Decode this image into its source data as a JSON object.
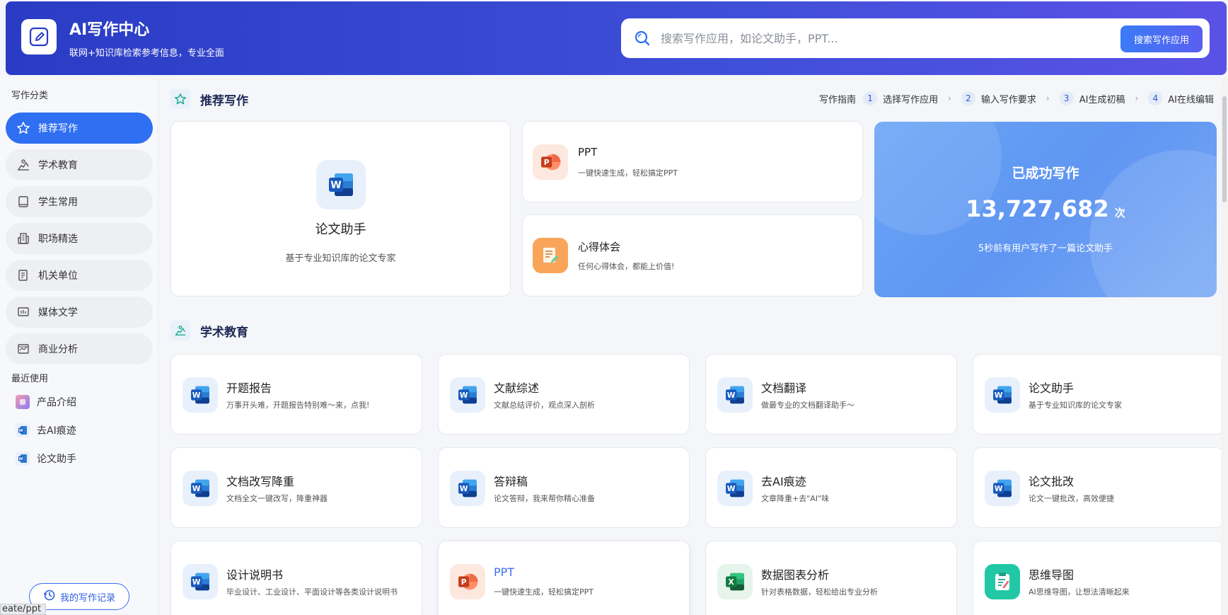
{
  "header": {
    "title": "AI写作中心",
    "subtitle": "联网+知识库检索参考信息，专业全面",
    "search_placeholder": "搜索写作应用，如论文助手，PPT...",
    "search_button": "搜索写作应用"
  },
  "sidebar": {
    "category_heading": "写作分类",
    "items": [
      {
        "label": "推荐写作",
        "icon": "star-icon"
      },
      {
        "label": "学术教育",
        "icon": "academic-icon"
      },
      {
        "label": "学生常用",
        "icon": "book-icon"
      },
      {
        "label": "职场精选",
        "icon": "building-icon"
      },
      {
        "label": "机关单位",
        "icon": "document-icon"
      },
      {
        "label": "媒体文学",
        "icon": "media-icon"
      },
      {
        "label": "商业分析",
        "icon": "chart-icon"
      }
    ],
    "recent_heading": "最近使用",
    "recent": [
      {
        "label": "产品介绍",
        "icon": "product-icon"
      },
      {
        "label": "去AI痕迹",
        "icon": "word-icon"
      },
      {
        "label": "论文助手",
        "icon": "word-icon"
      }
    ],
    "record_button": "我的写作记录"
  },
  "url_tooltip": "eate/ppt",
  "recommend": {
    "title": "推荐写作",
    "guide_label": "写作指南",
    "steps": [
      {
        "num": "1",
        "label": "选择写作应用"
      },
      {
        "num": "2",
        "label": "输入写作要求"
      },
      {
        "num": "3",
        "label": "AI生成初稿"
      },
      {
        "num": "4",
        "label": "AI在线编辑"
      }
    ],
    "feature": {
      "title": "论文助手",
      "desc": "基于专业知识库的论文专家"
    },
    "mini": [
      {
        "title": "PPT",
        "desc": "一键快速生成，轻松搞定PPT"
      },
      {
        "title": "心得体会",
        "desc": "任何心得体会，都能上价值!"
      }
    ],
    "stats": {
      "title": "已成功写作",
      "count": "13,727,682",
      "unit": "次",
      "note": "5秒前有用户写作了一篇论文助手"
    }
  },
  "academic": {
    "title": "学术教育",
    "apps": [
      {
        "title": "开题报告",
        "desc": "万事开头难，开题报告特别难～来，点我!",
        "type": "word"
      },
      {
        "title": "文献综述",
        "desc": "文献总结评价，观点深入剖析",
        "type": "word"
      },
      {
        "title": "文档翻译",
        "desc": "做最专业的文档翻译助手～",
        "type": "word"
      },
      {
        "title": "论文助手",
        "desc": "基于专业知识库的论文专家",
        "type": "word"
      },
      {
        "title": "文档改写降重",
        "desc": "文档全文一键改写，降重神器",
        "type": "word"
      },
      {
        "title": "答辩稿",
        "desc": "论文答辩，我来帮你精心准备",
        "type": "word"
      },
      {
        "title": "去AI痕迹",
        "desc": "文章降重+去\"AI\"味",
        "type": "word"
      },
      {
        "title": "论文批改",
        "desc": "论文一键批改，高效便捷",
        "type": "word"
      },
      {
        "title": "设计说明书",
        "desc": "毕业设计、工业设计、平面设计等各类设计说明书",
        "type": "word"
      },
      {
        "title": "PPT",
        "desc": "一键快速生成，轻松搞定PPT",
        "type": "ppt"
      },
      {
        "title": "数据图表分析",
        "desc": "针对表格数据，轻松给出专业分析",
        "type": "excel"
      },
      {
        "title": "思维导图",
        "desc": "AI思维导图，让想法清晰起来",
        "type": "mindmap"
      }
    ]
  }
}
